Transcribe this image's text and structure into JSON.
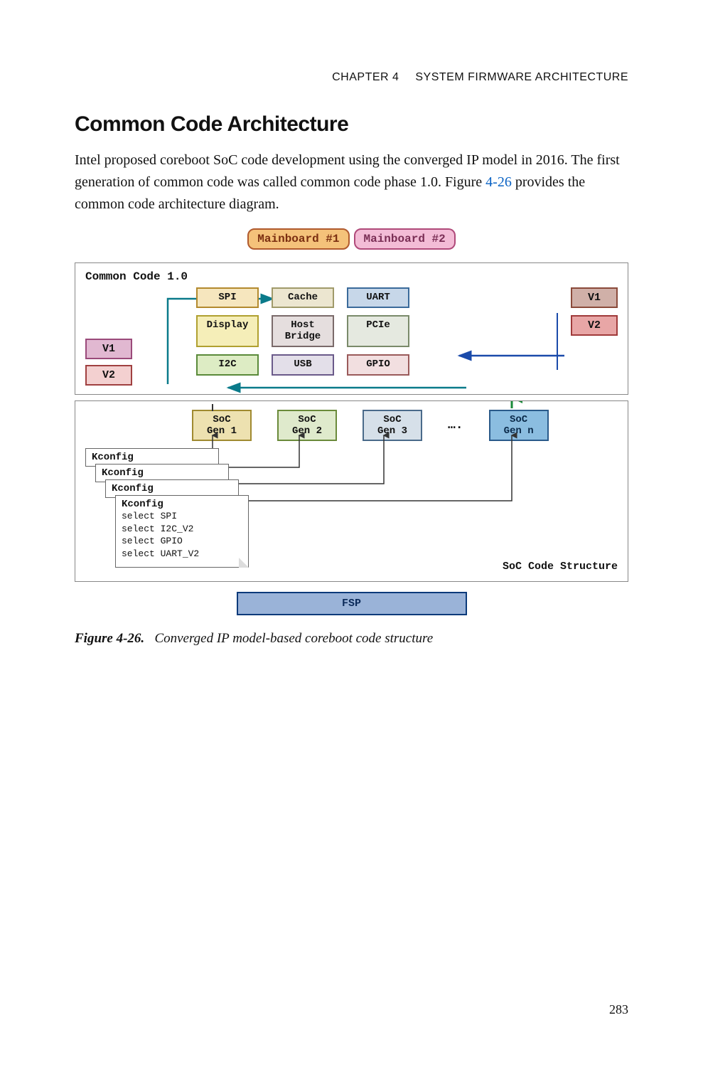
{
  "header": {
    "chapter_label": "CHAPTER 4",
    "chapter_title": "SYSTEM FIRMWARE ARCHITECTURE"
  },
  "section_heading": "Common Code Architecture",
  "paragraph_pre": "Intel proposed coreboot SoC code development using the converged IP model in 2016. The first generation of common code was called common code phase 1.0. Figure ",
  "figref": "4-26",
  "paragraph_post": " provides the common code architecture diagram.",
  "diagram": {
    "mainboards": [
      "Mainboard #1",
      "Mainboard #2"
    ],
    "common_code_label": "Common Code 1.0",
    "versions_left": [
      "V1",
      "V2"
    ],
    "modules": {
      "row1": [
        "SPI",
        "Cache",
        "UART"
      ],
      "row2": [
        "Display",
        "Host\nBridge",
        "PCIe"
      ],
      "row3": [
        "I2C",
        "USB",
        "GPIO"
      ]
    },
    "versions_right": [
      "V1",
      "V2"
    ],
    "soc_gens": [
      "SoC\nGen 1",
      "SoC\nGen 2",
      "SoC\nGen 3",
      "SoC\nGen n"
    ],
    "soc_dots": "….",
    "kconfig_label": "Kconfig",
    "kconfig_selects": [
      "select SPI",
      "select I2C_V2",
      "select GPIO",
      "select UART_V2"
    ],
    "soc_struct_label": "SoC Code Structure",
    "fsp": "FSP"
  },
  "figure_caption": {
    "label": "Figure 4-26.",
    "text": "Converged IP model-based coreboot code structure"
  },
  "page_number": "283"
}
